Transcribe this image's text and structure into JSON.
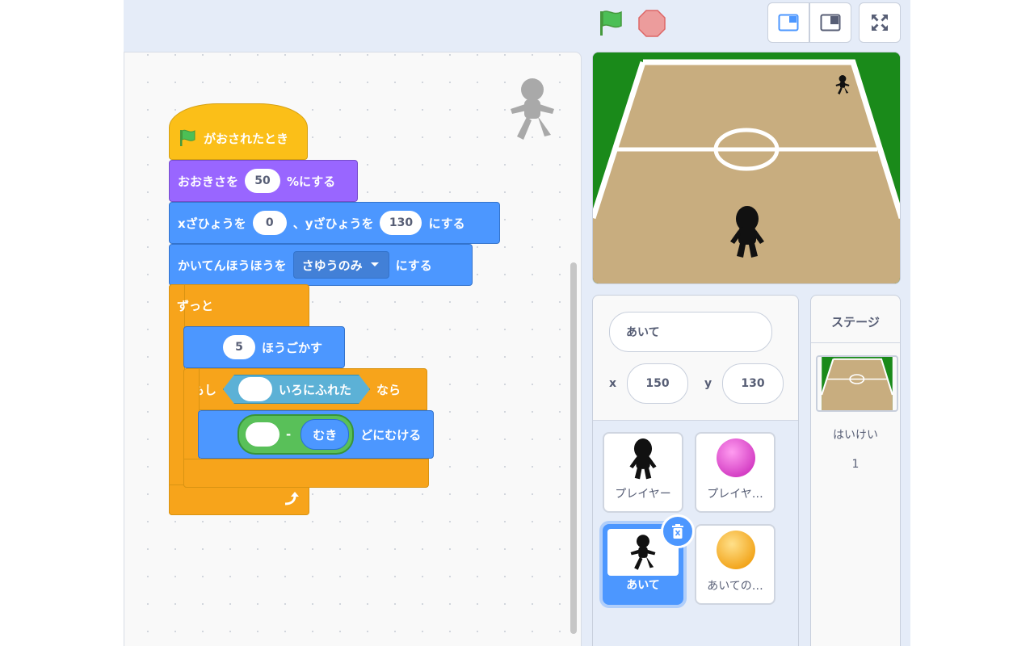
{
  "code": {
    "hat_label": "がおされたとき",
    "size": {
      "prefix": "おおきさを",
      "value": "50",
      "suffix": "%にする"
    },
    "goto": {
      "prefix": "xざひょうを",
      "x": "0",
      "mid": "、yざひょうを",
      "y": "130",
      "suffix": "にする"
    },
    "rotation": {
      "prefix": "かいてんほうほうを",
      "option": "さゆうのみ",
      "suffix": "にする"
    },
    "forever": "ずっと",
    "move": {
      "steps": "5",
      "label": "ほうごかす"
    },
    "if": {
      "prefix": "もし",
      "sensing": "いろにふれた",
      "suffix": "なら"
    },
    "point": {
      "minus": "-",
      "direction": "むき",
      "label": "どにむける"
    }
  },
  "sprite_info": {
    "name": "あいて",
    "x_label": "x",
    "x_value": "150",
    "y_label": "y",
    "y_value": "130"
  },
  "sprites": [
    {
      "name": "プレイヤー",
      "thumb": "player-silhouette"
    },
    {
      "name": "プレイヤ…",
      "thumb": "pink-ball"
    },
    {
      "name": "あいて",
      "thumb": "opponent-silhouette",
      "selected": true
    },
    {
      "name": "あいての…",
      "thumb": "orange-ball"
    }
  ],
  "stage_panel": {
    "title": "ステージ",
    "backdrop_label": "はいけい",
    "backdrop_count": "1"
  },
  "colors": {
    "events": "#fbbf18",
    "looks": "#9966ff",
    "motion": "#4c97ff",
    "control": "#f7a41b",
    "sensing": "#5cb1d6",
    "operators": "#59c059",
    "accent": "#4c97ff"
  }
}
